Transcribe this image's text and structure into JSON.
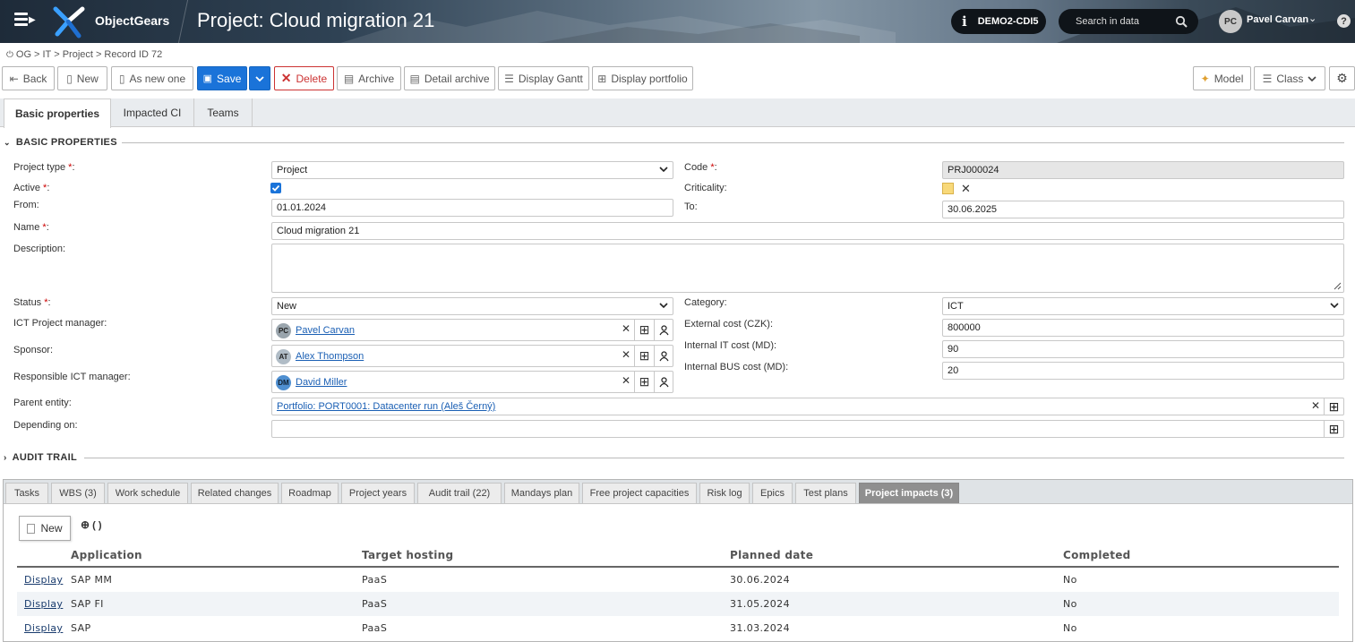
{
  "header": {
    "app_name": "ObjectGears",
    "title": "Project: Cloud migration 21",
    "environment": "DEMO2-CDI5",
    "search_placeholder": "Search in data",
    "user_initials": "PC",
    "user_name": "Pavel Carvan",
    "help": "?"
  },
  "breadcrumb": [
    "OG",
    ">",
    "IT",
    ">",
    "Project",
    ">",
    "Record ID 72"
  ],
  "toolbar": {
    "back": "Back",
    "new": "New",
    "as_new_one": "As new one",
    "save": "Save",
    "delete": "Delete",
    "archive": "Archive",
    "detail_archive": "Detail archive",
    "display_gantt": "Display Gantt",
    "display_portfolio": "Display portfolio",
    "model": "Model",
    "class": "Class"
  },
  "main_tabs": [
    "Basic properties",
    "Impacted CI",
    "Teams"
  ],
  "sections": {
    "basic": "BASIC PROPERTIES",
    "audit": "AUDIT TRAIL"
  },
  "form": {
    "project_type": {
      "label": "Project type",
      "value": "Project"
    },
    "code": {
      "label": "Code",
      "value": "PRJ000024"
    },
    "active": {
      "label": "Active",
      "checked": true
    },
    "criticality": {
      "label": "Criticality:",
      "color": "#f8d97a"
    },
    "from": {
      "label": "From:",
      "value": "01.01.2024"
    },
    "to": {
      "label": "To:",
      "value": "30.06.2025"
    },
    "name": {
      "label": "Name",
      "value": "Cloud migration 21"
    },
    "description": {
      "label": "Description:",
      "value": ""
    },
    "status": {
      "label": "Status",
      "value": "New"
    },
    "category": {
      "label": "Category:",
      "value": "ICT"
    },
    "ict_pm": {
      "label": "ICT Project manager:",
      "initials": "PC",
      "value": "Pavel Carvan"
    },
    "sponsor": {
      "label": "Sponsor:",
      "initials": "AT",
      "value": "Alex Thompson"
    },
    "resp_ict": {
      "label": "Responsible ICT manager:",
      "initials": "DM",
      "value": "David Miller"
    },
    "ext_cost": {
      "label": "External cost (CZK):",
      "value": "800000"
    },
    "int_it_cost": {
      "label": "Internal IT cost (MD):",
      "value": "90"
    },
    "int_bus_cost": {
      "label": "Internal BUS cost (MD):",
      "value": "20"
    },
    "parent": {
      "label": "Parent entity:",
      "value": "Portfolio: PORT0001: Datacenter run (Aleš Černý)"
    },
    "depending": {
      "label": "Depending on:",
      "value": ""
    }
  },
  "bottom_tabs": [
    "Tasks",
    "WBS (3)",
    "Work schedule",
    "Related changes",
    "Roadmap",
    "Project years",
    "Audit trail (22)",
    "Mandays plan",
    "Free project capacities",
    "Risk log",
    "Epics",
    "Test plans",
    "Project impacts (3)"
  ],
  "impacts": {
    "new_label": "New",
    "plus_label": "( )",
    "columns": [
      "Application",
      "Target hosting",
      "Planned date",
      "Completed"
    ],
    "rows": [
      {
        "action": "Display",
        "application": "SAP MM",
        "hosting": "PaaS",
        "date": "30.06.2024",
        "completed": "No"
      },
      {
        "action": "Display",
        "application": "SAP FI",
        "hosting": "PaaS",
        "date": "31.05.2024",
        "completed": "No"
      },
      {
        "action": "Display",
        "application": "SAP",
        "hosting": "PaaS",
        "date": "31.03.2024",
        "completed": "No"
      }
    ]
  }
}
